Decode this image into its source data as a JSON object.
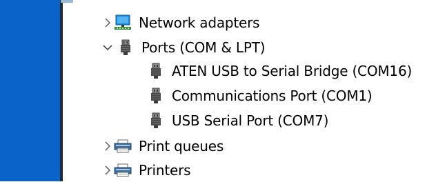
{
  "tree": {
    "items": [
      {
        "label": "Network adapters",
        "icon": "network-adapter-icon",
        "expander": "chevron-right-icon"
      },
      {
        "label": "Ports (COM & LPT)",
        "icon": "port-connector-icon",
        "expander": "chevron-down-icon"
      },
      {
        "label": "ATEN USB to Serial Bridge (COM16)",
        "icon": "port-connector-icon"
      },
      {
        "label": "Communications Port (COM1)",
        "icon": "port-connector-icon"
      },
      {
        "label": "USB Serial Port (COM7)",
        "icon": "port-connector-icon"
      },
      {
        "label": "Print queues",
        "icon": "printer-icon",
        "expander": "chevron-right-icon"
      },
      {
        "label": "Printers",
        "icon": "printer-icon",
        "expander": "chevron-right-icon"
      }
    ]
  },
  "colors": {
    "left_panel": "#0a63c8",
    "chevron": "#6b6b6b",
    "port_icon": "#4a4a4a",
    "network_icon": "#1e88d6",
    "printer_icon": "#3c6e9e"
  }
}
